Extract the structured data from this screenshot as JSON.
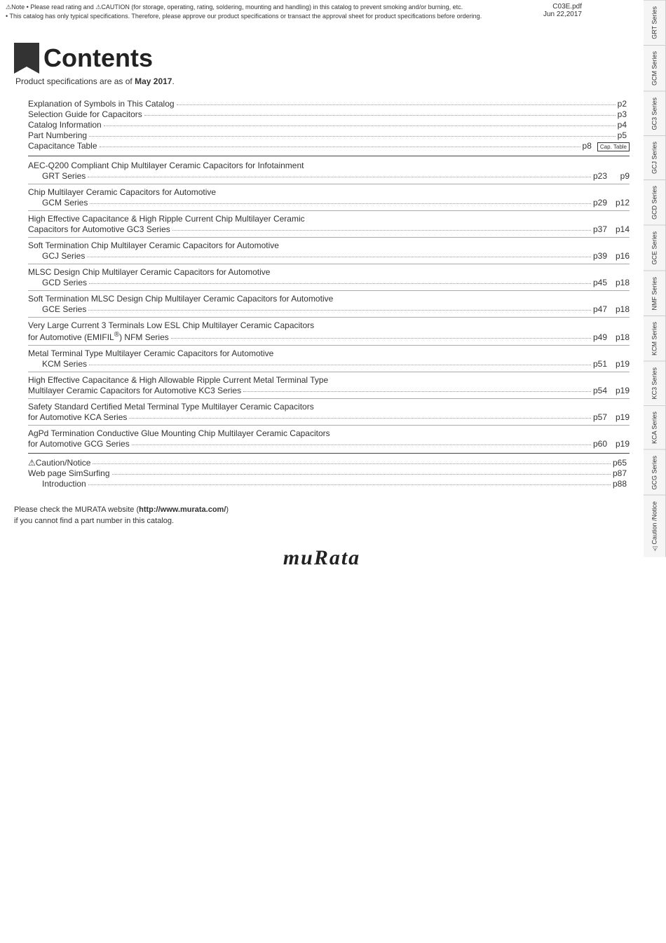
{
  "topNotice": {
    "line1": "⚠Note  • Please read rating and ⚠CAUTION (for storage, operating, rating, soldering, mounting and handling) in this catalog to prevent smoking and/or burning, etc.",
    "line2": "• This catalog has only typical specifications. Therefore, please approve our product specifications or transact the approval sheet for product specifications before ordering."
  },
  "topRight": {
    "filename": "C03E.pdf",
    "date": "Jun 22,2017"
  },
  "contents": {
    "title": "Contents",
    "subtitle": "Product specifications are as of May 2017."
  },
  "toc": {
    "simpleItems": [
      {
        "title": "Explanation of Symbols in This Catalog",
        "page": "p2",
        "page2": ""
      },
      {
        "title": "Selection Guide for Capacitors",
        "page": "p3",
        "page2": ""
      },
      {
        "title": "Catalog Information",
        "page": "p4",
        "page2": ""
      },
      {
        "title": "Part Numbering",
        "page": "p5",
        "page2": ""
      },
      {
        "title": "Capacitance Table",
        "page": "p8",
        "page2": "",
        "capTable": "Cap. Table"
      }
    ],
    "sections": [
      {
        "heading": "AEC-Q200 Compliant Chip Multilayer Ceramic Capacitors for Infotainment",
        "sub": "GRT Series",
        "subDots": true,
        "subPage": "p23",
        "p2": "p9"
      },
      {
        "heading": "Chip Multilayer Ceramic Capacitors for Automotive",
        "sub": "GCM Series",
        "subDots": true,
        "subPage": "p29",
        "p2": "p12"
      },
      {
        "heading": "High Effective Capacitance & High Ripple Current Chip Multilayer Ceramic",
        "heading2": "Capacitors for Automotive   GC3 Series",
        "subDots": true,
        "subPage": "p37",
        "p2": "p14"
      },
      {
        "heading": "Soft Termination Chip Multilayer Ceramic Capacitors for Automotive",
        "sub": "GCJ Series",
        "subDots": true,
        "subPage": "p39",
        "p2": "p16"
      },
      {
        "heading": "MLSC Design Chip Multilayer Ceramic Capacitors for Automotive",
        "sub": "GCD Series",
        "subDots": true,
        "subPage": "p45",
        "p2": "p18"
      },
      {
        "heading": "Soft Termination MLSC Design Chip Multilayer Ceramic Capacitors for Automotive",
        "sub": "GCE Series",
        "subDots": true,
        "subPage": "p47",
        "p2": "p18"
      },
      {
        "heading": "Very Large Current 3 Terminals Low ESL Chip Multilayer Ceramic Capacitors",
        "heading2": "for Automotive  (EMIFIL®)   NFM Series",
        "subDots": true,
        "subPage": "p49",
        "p2": "p18"
      },
      {
        "heading": "Metal Terminal Type Multilayer Ceramic Capacitors for Automotive",
        "sub": "KCM Series",
        "subDots": true,
        "subPage": "p51",
        "p2": "p19"
      },
      {
        "heading": "High Effective Capacitance & High Allowable Ripple Current Metal Terminal Type",
        "heading2": "Multilayer Ceramic Capacitors for Automotive   KC3 Series",
        "subDots": true,
        "subPage": "p54",
        "p2": "p19"
      },
      {
        "heading": "Safety Standard Certified Metal Terminal Type Multilayer Ceramic Capacitors",
        "heading2": "for Automotive   KCA Series",
        "subDots": true,
        "subPage": "p57",
        "p2": "p19"
      },
      {
        "heading": "AgPd Termination Conductive Glue Mounting Chip Multilayer Ceramic Capacitors",
        "heading2": "for Automotive   GCG Series",
        "subDots": true,
        "subPage": "p60",
        "p2": "p19"
      }
    ],
    "footerItems": [
      {
        "title": "⚠Caution/Notice",
        "page": "p65",
        "page2": ""
      },
      {
        "title": "Web page SimSurfing",
        "page": "p87",
        "page2": ""
      },
      {
        "title": "Introduction",
        "page": "p88",
        "page2": "",
        "indent": true
      }
    ]
  },
  "footer": {
    "line1": "Please check the MURATA website (http://www.murata.com/)",
    "line2": "if you cannot find a part number in this catalog."
  },
  "logo": "muRata",
  "sidebar": {
    "tabs": [
      "GRT Series",
      "GCM Series",
      "GC3 Series",
      "GCJ Series",
      "GCD Series",
      "GCE Series",
      "NMF Series",
      "KCM Series",
      "KC3 Series",
      "KCA Series",
      "GCG Series",
      "⚠Caution /Notice"
    ]
  }
}
